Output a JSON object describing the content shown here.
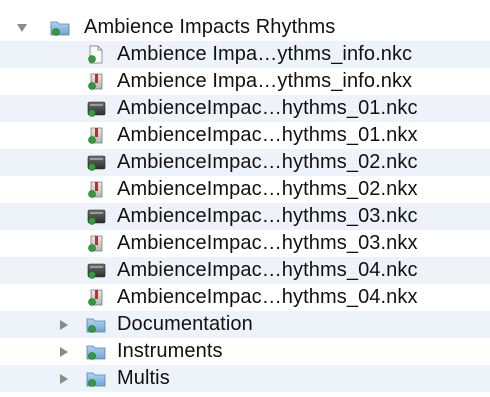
{
  "tree": {
    "root": {
      "label": "Ambience Impacts Rhythms",
      "expanded": true,
      "icon": "folder-icon"
    },
    "files": [
      {
        "label": "Ambience Impa…ythms_info.nkc",
        "icon": "nkc-document-icon"
      },
      {
        "label": "Ambience Impa…ythms_info.nkx",
        "icon": "nkx-resource-icon"
      },
      {
        "label": "AmbienceImpac…hythms_01.nkc",
        "icon": "nkc-database-icon"
      },
      {
        "label": "AmbienceImpac…hythms_01.nkx",
        "icon": "nkx-resource-icon"
      },
      {
        "label": "AmbienceImpac…hythms_02.nkc",
        "icon": "nkc-database-icon"
      },
      {
        "label": "AmbienceImpac…hythms_02.nkx",
        "icon": "nkx-resource-icon"
      },
      {
        "label": "AmbienceImpac…hythms_03.nkc",
        "icon": "nkc-database-icon"
      },
      {
        "label": "AmbienceImpac…hythms_03.nkx",
        "icon": "nkx-resource-icon"
      },
      {
        "label": "AmbienceImpac…hythms_04.nkc",
        "icon": "nkc-database-icon"
      },
      {
        "label": "AmbienceImpac…hythms_04.nkx",
        "icon": "nkx-resource-icon"
      }
    ],
    "folders": [
      {
        "label": "Documentation",
        "expanded": false,
        "icon": "folder-icon"
      },
      {
        "label": "Instruments",
        "expanded": false,
        "icon": "folder-icon"
      },
      {
        "label": "Multis",
        "expanded": false,
        "icon": "folder-icon"
      }
    ]
  },
  "colors": {
    "row_stripe": "#eef3fa",
    "folder_blue": "#7aaedb",
    "badge_green": "#2f9e3a",
    "disclosure_gray": "#8a8a8a"
  }
}
